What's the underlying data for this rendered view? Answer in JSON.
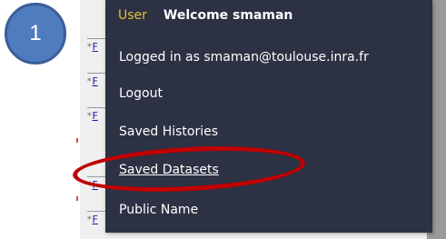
{
  "callout": {
    "number": "1"
  },
  "menu": {
    "header": {
      "label": "User",
      "welcome": "Welcome smaman"
    },
    "items": [
      {
        "label": "Logged in as smaman@toulouse.inra.fr",
        "underlined": false
      },
      {
        "label": "Logout",
        "underlined": false
      },
      {
        "label": "Saved Histories",
        "underlined": false
      },
      {
        "label": "Saved Datasets",
        "underlined": true
      },
      {
        "label": "Public Name",
        "underlined": false
      }
    ]
  },
  "background": {
    "row_star": "*",
    "row_link": "F"
  },
  "colors": {
    "menu_bg": "#2c3143",
    "header_label": "#e8c23a",
    "highlight": "#c00000",
    "callout": "#4f7bbf"
  }
}
